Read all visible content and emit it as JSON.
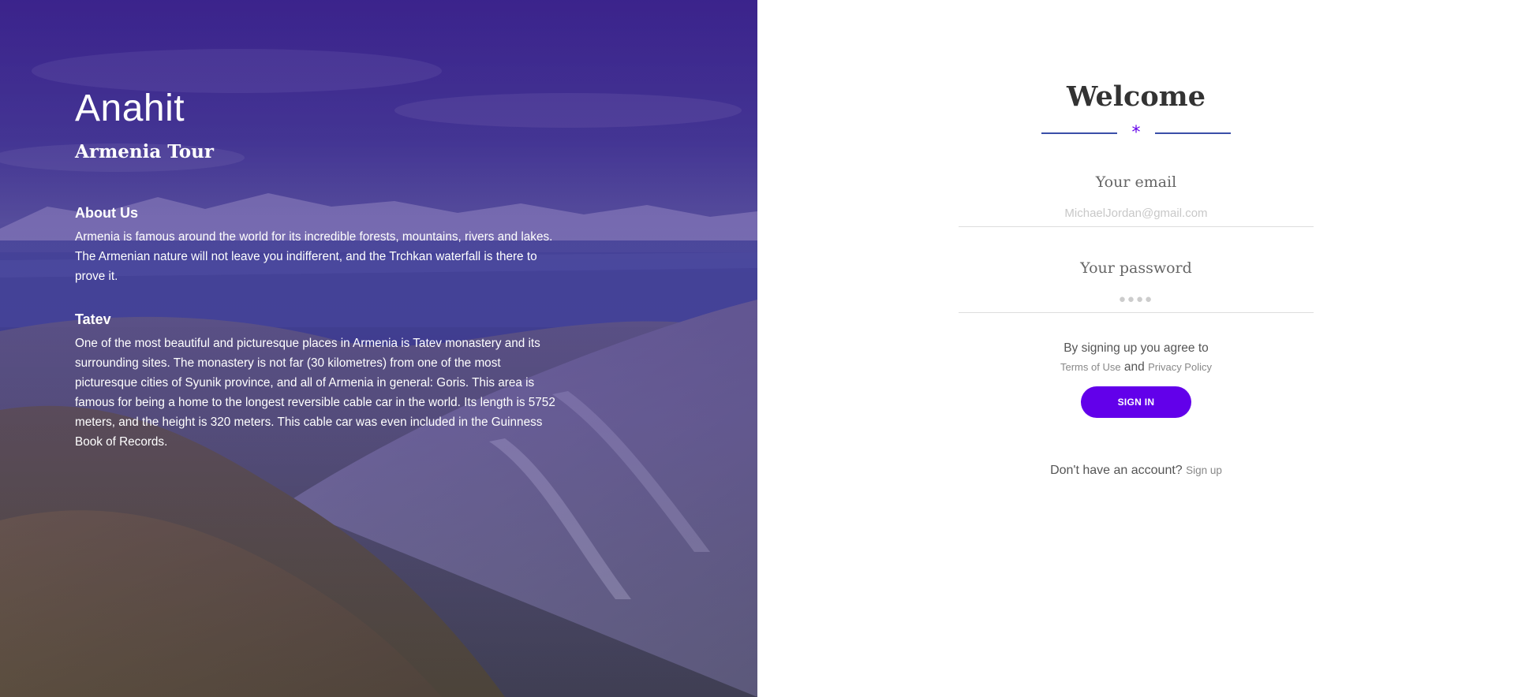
{
  "hero": {
    "brand": "Anahit",
    "tagline": "Armenia Tour",
    "sections": [
      {
        "title": "About Us",
        "text": "Armenia is famous around the world for its incredible forests, mountains, rivers and lakes. The Armenian nature will not leave you indifferent, and the Trchkan waterfall is there to prove it."
      },
      {
        "title": "Tatev",
        "text": "One of the most beautiful and picturesque places in Armenia is Tatev monastery and its surrounding sites. The monastery is not far (30 kilometres) from one of the most picturesque cities of Syunik province, and all of Armenia in general: Goris. This area is famous for being a home to the longest reversible cable car in the world. Its length is 5752 meters, and the height is 320 meters. This cable car was even included in the Guinness Book of Records."
      }
    ]
  },
  "login": {
    "title": "Welcome",
    "divider_icon": "*",
    "email_label": "Your email",
    "email_placeholder": "MichaelJordan@gmail.com",
    "password_label": "Your password",
    "password_value": "●●●●",
    "terms_prefix": "By signing up you agree to",
    "terms_link": "Terms of Use",
    "terms_and": "and",
    "privacy_link": "Privacy Policy",
    "signin_label": "SIGN IN",
    "signup_prompt": "Don't have an account?",
    "signup_link": "Sign up"
  },
  "colors": {
    "accent": "#6200ea",
    "divider": "#3a4fa8",
    "overlay": "#3c1e8c"
  }
}
